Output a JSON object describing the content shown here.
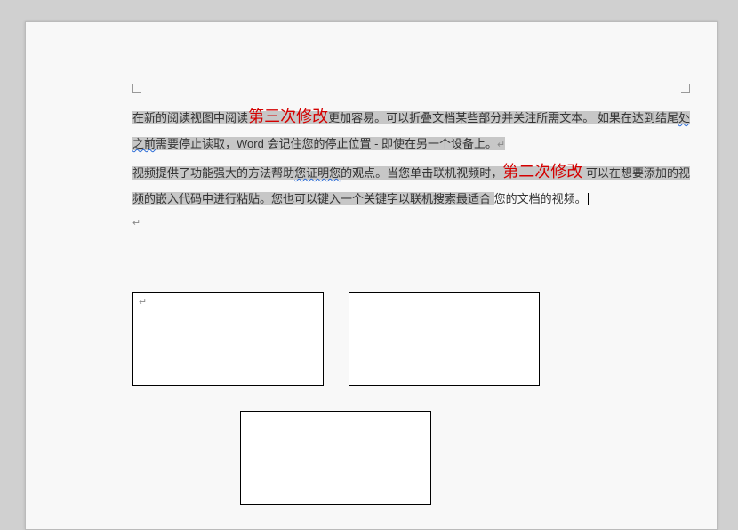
{
  "paragraph": {
    "line1a": "在新的阅读视图中阅读",
    "edit1": "第三次修改",
    "line1b": "更加容易。可以折叠文档某些部分并关注所需文本。",
    "line2a": "如果在达到结尾",
    "sq1": "处之前",
    "line2b": "需要停止读取，Word  会记住您的停止位置  -  即使在另一个设备上。",
    "line3a": "视频提供了功能强大的方法帮助",
    "sq2": "您证明您",
    "line3b": "的观点。当您单击联机视频时，",
    "edit2": "第二次修改",
    "line4": "可以在想要添加的视频的嵌入代码中进行粘贴。您也可以键入一个关键字以联机搜索最适合",
    "line5": "您的文档的视频。"
  },
  "marks": {
    "para": "↵"
  },
  "boxes": {
    "b1_content": "↵",
    "b2_content": "",
    "b3_content": ""
  }
}
